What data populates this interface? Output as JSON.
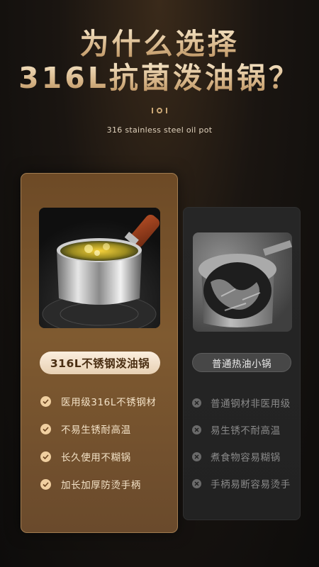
{
  "headline": {
    "line1": "为什么选择",
    "line2": "316L抗菌泼油锅？"
  },
  "subtitle": "316 stainless steel oil pot",
  "left_card": {
    "badge": "316L不锈钢泼油锅",
    "features": [
      "医用级316L不锈钢材",
      "不易生锈耐高温",
      "长久使用不糊锅",
      "加长加厚防烫手柄"
    ],
    "icon": "check-icon",
    "accent": "#f0cfa0"
  },
  "right_card": {
    "badge": "普通热油小锅",
    "features": [
      "普通钢材非医用级",
      "易生锈不耐高温",
      "煮食物容易糊锅",
      "手柄易断容易烫手"
    ],
    "icon": "cross-icon"
  }
}
